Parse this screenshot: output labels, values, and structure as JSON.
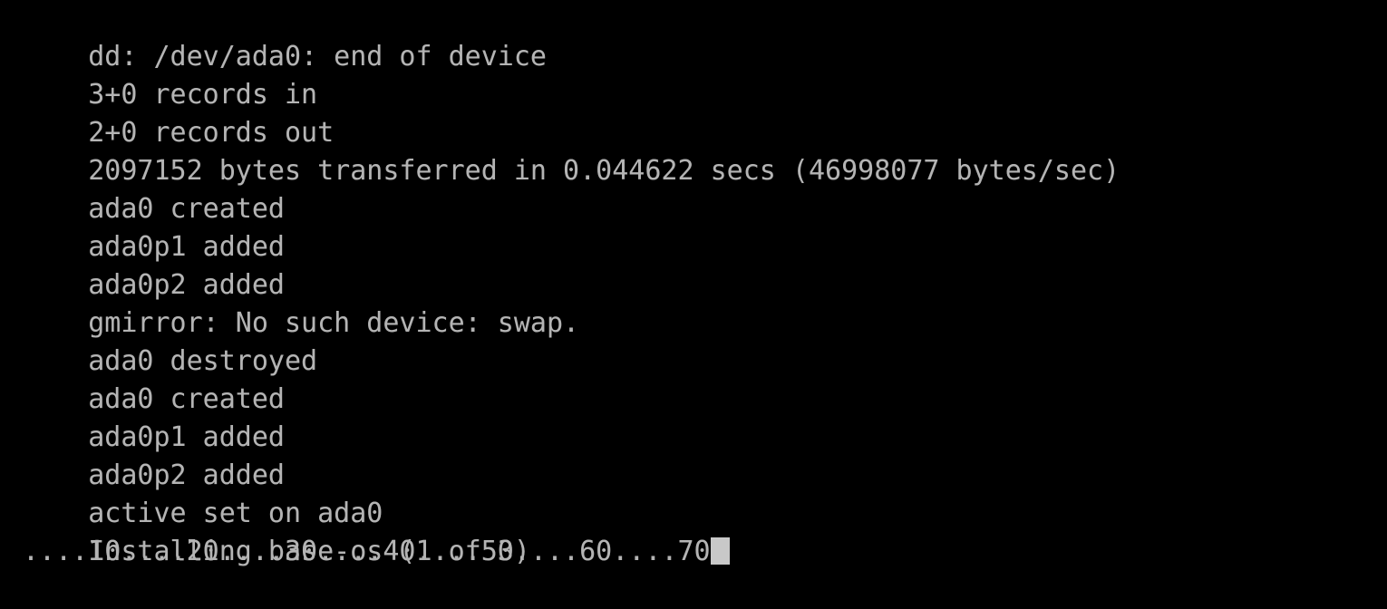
{
  "terminal": {
    "background_color": "#000000",
    "foreground_color": "#b4b4b4",
    "cursor_color": "#c8c8c8",
    "cursor_shape": "block",
    "lines": [
      {
        "text": "dd: /dev/ada0: end of device"
      },
      {
        "text": "3+0 records in"
      },
      {
        "text": "2+0 records out"
      },
      {
        "text": "2097152 bytes transferred in 0.044622 secs (46998077 bytes/sec)"
      },
      {
        "text": "ada0 created"
      },
      {
        "text": "ada0p1 added"
      },
      {
        "text": "ada0p2 added"
      },
      {
        "text": "gmirror: No such device: swap."
      },
      {
        "text": "ada0 destroyed"
      },
      {
        "text": "ada0 created"
      },
      {
        "text": "ada0p1 added"
      },
      {
        "text": "ada0p2 added"
      },
      {
        "text": "active set on ada0"
      },
      {
        "text": "Installing base-os (1 of 3)"
      },
      {
        "text": "....10....20....30....40....50....60....70"
      }
    ],
    "progress": {
      "line_index": 14,
      "marks": [
        "10",
        "20",
        "30",
        "40",
        "50",
        "60",
        "70"
      ],
      "current_percent": 70,
      "dots_per_segment": 4
    },
    "install": {
      "package_name": "base-os",
      "step_current": 1,
      "step_total": 3,
      "status_text": "Installing base-os (1 of 3)"
    },
    "dd_result": {
      "error_text": "dd: /dev/ada0: end of device",
      "records_in": "3+0",
      "records_out": "2+0",
      "bytes_transferred": "2097152",
      "seconds": "0.044622",
      "rate_bytes_per_sec": "46998077"
    }
  }
}
